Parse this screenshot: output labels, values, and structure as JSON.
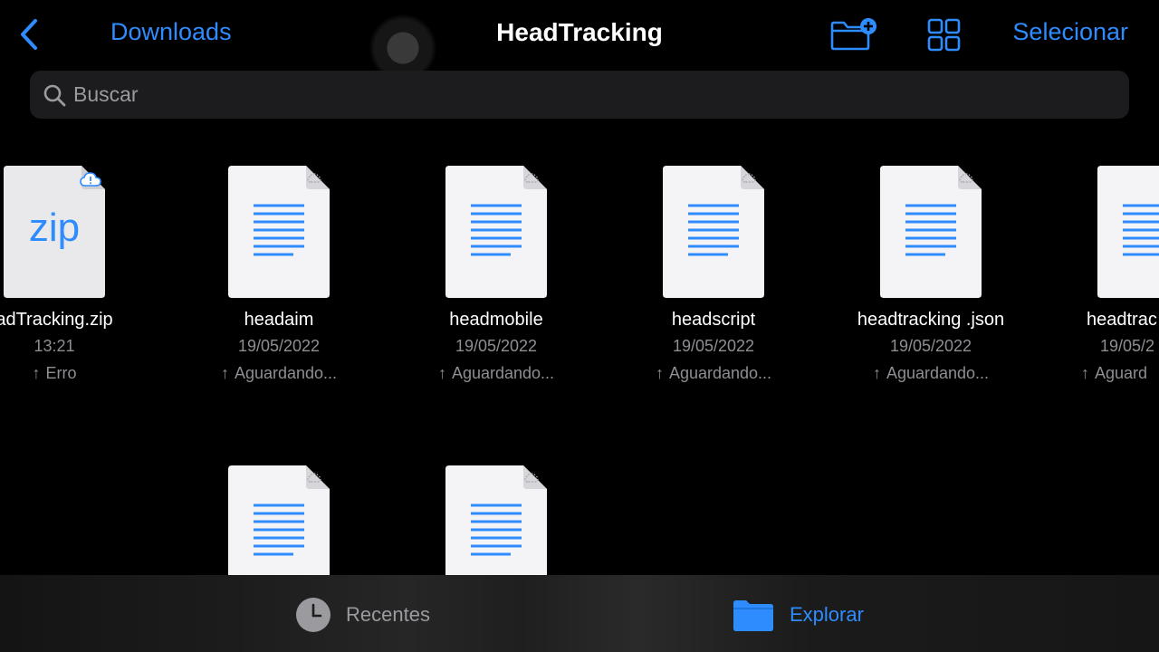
{
  "header": {
    "back_label": "Downloads",
    "title": "HeadTracking",
    "select_label": "Selecionar"
  },
  "search": {
    "placeholder": "Buscar"
  },
  "files": [
    {
      "name": "adTracking.zip",
      "date": "13:21",
      "status": "Erro",
      "type": "zip",
      "thumb_label": "zip",
      "cloud": "error"
    },
    {
      "name": "headaim",
      "date": "19/05/2022",
      "status": "Aguardando...",
      "type": "document",
      "cloud": "pending"
    },
    {
      "name": "headmobile",
      "date": "19/05/2022",
      "status": "Aguardando...",
      "type": "document",
      "cloud": "pending"
    },
    {
      "name": "headscript",
      "date": "19/05/2022",
      "status": "Aguardando...",
      "type": "document",
      "cloud": "pending"
    },
    {
      "name": "headtracking .json",
      "date": "19/05/2022",
      "status": "Aguardando...",
      "type": "document",
      "cloud": "pending"
    },
    {
      "name": "headtrac",
      "date": "19/05/2",
      "status": "Aguard",
      "type": "document",
      "cloud": "pending"
    },
    {
      "name": "",
      "date": "",
      "status": "",
      "type": "document",
      "cloud": "pending"
    },
    {
      "name": "",
      "date": "",
      "status": "",
      "type": "document",
      "cloud": "pending"
    }
  ],
  "tabs": [
    {
      "label": "Recentes",
      "icon": "clock-icon",
      "active": false
    },
    {
      "label": "Explorar",
      "icon": "folder-icon",
      "active": true
    }
  ],
  "colors": {
    "accent": "#2f8cff",
    "background": "#000000",
    "secondary_text": "#8e8e93"
  }
}
